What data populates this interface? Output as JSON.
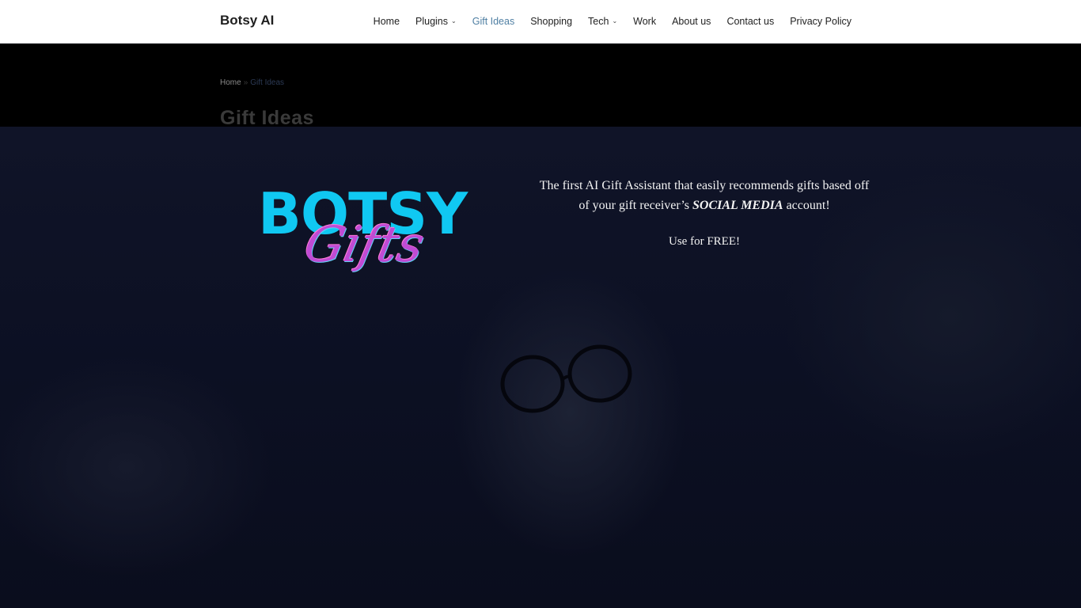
{
  "header": {
    "brand": "Botsy AI",
    "nav": [
      {
        "label": "Home",
        "has_dropdown": false
      },
      {
        "label": "Plugins",
        "has_dropdown": true
      },
      {
        "label": "Gift Ideas",
        "has_dropdown": false,
        "active": true
      },
      {
        "label": "Shopping",
        "has_dropdown": false
      },
      {
        "label": "Tech",
        "has_dropdown": true
      },
      {
        "label": "Work",
        "has_dropdown": false
      },
      {
        "label": "About us",
        "has_dropdown": false
      },
      {
        "label": "Contact us",
        "has_dropdown": false
      },
      {
        "label": "Privacy Policy",
        "has_dropdown": false
      }
    ],
    "chevron_icon": "chevron-down-icon",
    "active_color": "#4f7fa3"
  },
  "breadcrumb": {
    "home": "Home",
    "separator": "»",
    "current": "Gift Ideas"
  },
  "page_title": "Gift Ideas",
  "hero": {
    "logo_word": "BOTSY",
    "logo_script": "Gifts",
    "tagline_part1": "The first AI Gift Assistant that easily recommends gifts based off of your gift receiver’s",
    "tagline_emphasis": "SOCIAL MEDIA",
    "tagline_part2": "account!",
    "cta": "Use for FREE!",
    "logo_color": "#10c8f2",
    "script_color": "#c04bd4"
  }
}
